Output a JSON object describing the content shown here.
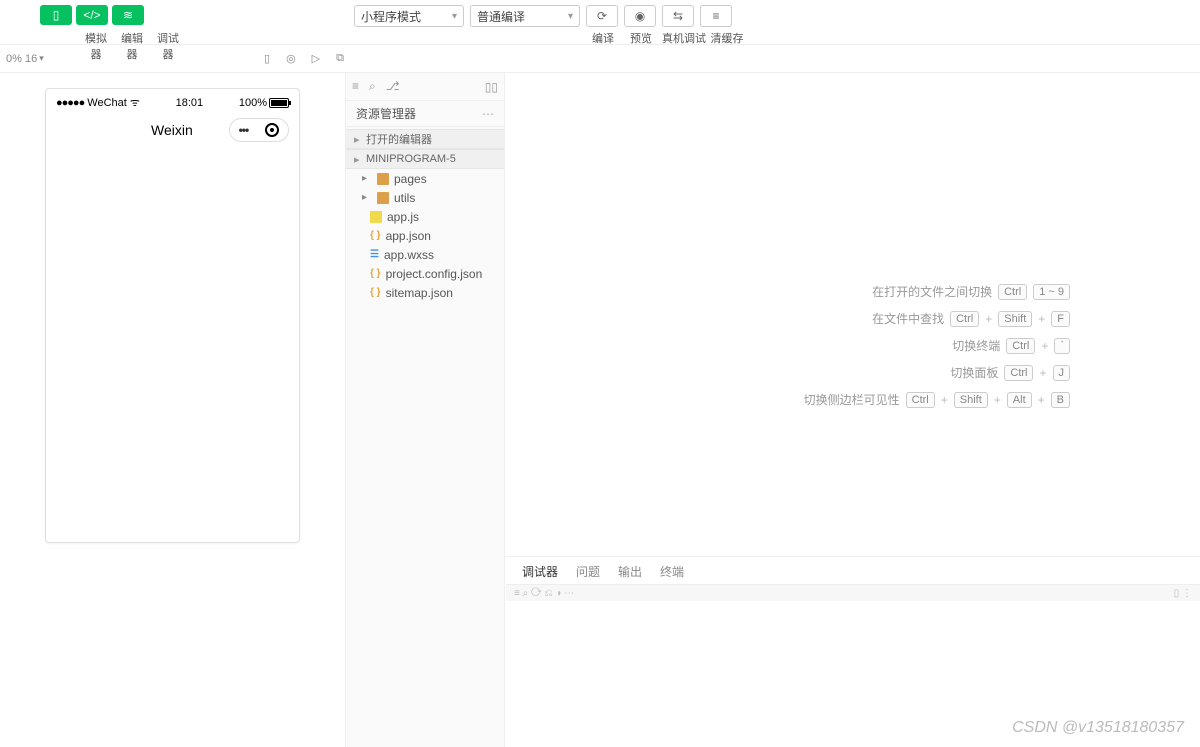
{
  "toolbar": {
    "tabs": {
      "simulator": "模拟器",
      "editor": "编辑器",
      "debugger": "调试器"
    },
    "mode_dropdown": "小程序模式",
    "compile_dropdown": "普通编译",
    "actions": {
      "compile": "编译",
      "preview": "预览",
      "remote_debug": "真机调试",
      "clear_cache": "清缓存"
    }
  },
  "subbar": {
    "zoom": "0% 16"
  },
  "simulator": {
    "carrier": "WeChat",
    "time": "18:01",
    "battery_pct": "100%",
    "app_title": "Weixin"
  },
  "explorer": {
    "title": "资源管理器",
    "open_editors": "打开的编辑器",
    "project": "MINIPROGRAM-5",
    "items": [
      {
        "label": "pages",
        "type": "folder"
      },
      {
        "label": "utils",
        "type": "folder"
      },
      {
        "label": "app.js",
        "type": "js"
      },
      {
        "label": "app.json",
        "type": "json"
      },
      {
        "label": "app.wxss",
        "type": "wxss"
      },
      {
        "label": "project.config.json",
        "type": "json"
      },
      {
        "label": "sitemap.json",
        "type": "json"
      }
    ]
  },
  "shortcuts": [
    {
      "label": "在打开的文件之间切换",
      "keys": [
        "Ctrl",
        "1 ~ 9"
      ]
    },
    {
      "label": "在文件中查找",
      "keys": [
        "Ctrl",
        "+",
        "Shift",
        "+",
        "F"
      ]
    },
    {
      "label": "切换终端",
      "keys": [
        "Ctrl",
        "+",
        "`"
      ]
    },
    {
      "label": "切换面板",
      "keys": [
        "Ctrl",
        "+",
        "J"
      ]
    },
    {
      "label": "切换侧边栏可见性",
      "keys": [
        "Ctrl",
        "+",
        "Shift",
        "+",
        "Alt",
        "+",
        "B"
      ]
    }
  ],
  "bottom_panel": {
    "tabs": {
      "debugger": "调试器",
      "problems": "问题",
      "output": "输出",
      "terminal": "终端"
    }
  },
  "watermark": "CSDN @v13518180357"
}
